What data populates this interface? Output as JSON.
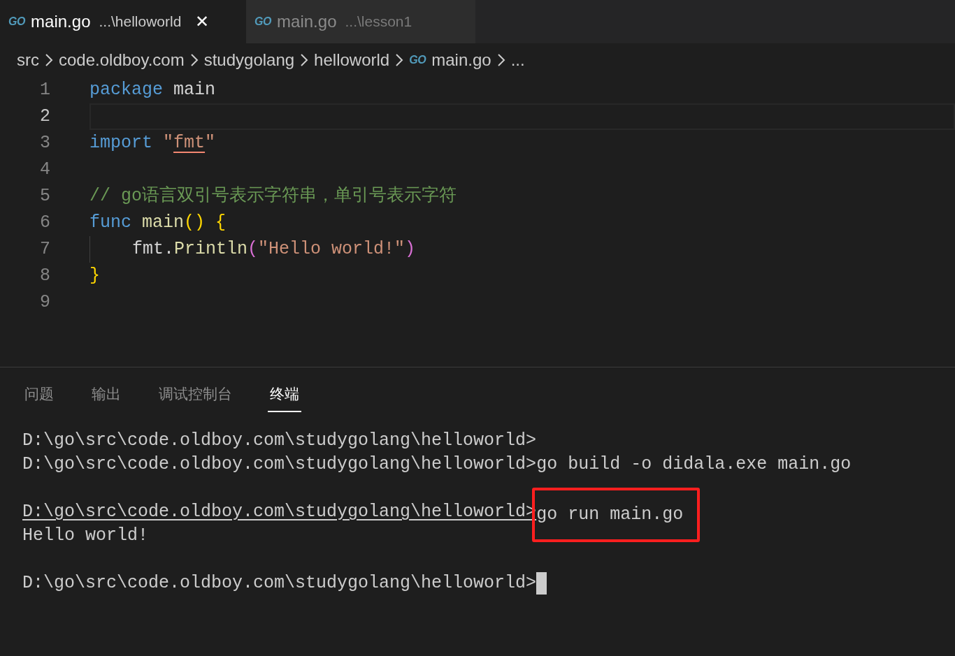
{
  "tabs": [
    {
      "icon": "GO",
      "name": "main.go",
      "path": "...\\helloworld",
      "selected": true,
      "close": "✕"
    },
    {
      "icon": "GO",
      "name": "main.go",
      "path": "...\\lesson1",
      "selected": false
    }
  ],
  "breadcrumb": [
    {
      "label": "src"
    },
    {
      "label": "code.oldboy.com"
    },
    {
      "label": "studygolang"
    },
    {
      "label": "helloworld"
    },
    {
      "label": "main.go",
      "icon": "GO"
    },
    {
      "label": "..."
    }
  ],
  "editor": {
    "lines": [
      {
        "number": "1",
        "current": false,
        "tokens": [
          {
            "kind": "keyword",
            "text": "package"
          },
          {
            "kind": "plain",
            "text": " main"
          }
        ]
      },
      {
        "number": "2",
        "current": true
      },
      {
        "number": "3",
        "current": false,
        "tokens": [
          {
            "kind": "keyword",
            "text": "import "
          },
          {
            "kind": "string",
            "text": "\""
          },
          {
            "kind": "string_squiggle",
            "text": "fmt"
          },
          {
            "kind": "string",
            "text": "\""
          }
        ]
      },
      {
        "number": "4",
        "current": false
      },
      {
        "number": "5",
        "current": false,
        "tokens": [
          {
            "kind": "comment",
            "text": "// go语言双引号表示字符串，单引号表示字符"
          }
        ]
      },
      {
        "number": "6",
        "current": false,
        "tokens": [
          {
            "kind": "keyword",
            "text": "func "
          },
          {
            "kind": "func",
            "text": "main"
          },
          {
            "kind": "bracket",
            "text": "()"
          },
          {
            "kind": "bracket",
            "text": " {"
          }
        ]
      },
      {
        "number": "7",
        "current": false,
        "indent": true,
        "tokens": [
          {
            "kind": "plain",
            "text": "fmt."
          },
          {
            "kind": "func",
            "text": "Println"
          },
          {
            "kind": "bracket2",
            "text": "("
          },
          {
            "kind": "string",
            "text": "\"Hello world!\""
          },
          {
            "kind": "bracket2",
            "text": ")"
          }
        ]
      },
      {
        "number": "8",
        "current": false,
        "tokens": [
          {
            "kind": "bracket",
            "text": "}"
          }
        ]
      },
      {
        "number": "9",
        "current": false
      }
    ]
  },
  "panel_tabs": [
    {
      "label": "问题",
      "selected": false
    },
    {
      "label": "输出",
      "selected": false
    },
    {
      "label": "调试控制台",
      "selected": false
    },
    {
      "label": "终端",
      "selected": true
    }
  ],
  "terminal": [
    {
      "kind": "prompt",
      "prompt": "D:\\go\\src\\code.oldboy.com\\studygolang\\helloworld>",
      "underlined": false
    },
    {
      "kind": "prompt",
      "prompt": "D:\\go\\src\\code.oldboy.com\\studygolang\\helloworld>",
      "command": "go build -o didala.exe main.go",
      "underlined": false
    },
    {
      "kind": "blank"
    },
    {
      "kind": "prompt",
      "prompt": "D:\\go\\src\\code.oldboy.com\\studygolang\\helloworld>",
      "command": "go run main.go",
      "underlined": true,
      "highlighted": true
    },
    {
      "kind": "output",
      "output": "Hello world!"
    },
    {
      "kind": "blank"
    },
    {
      "kind": "prompt",
      "prompt": "D:\\go\\src\\code.oldboy.com\\studygolang\\helloworld>",
      "underlined": false,
      "cursor": true
    }
  ]
}
